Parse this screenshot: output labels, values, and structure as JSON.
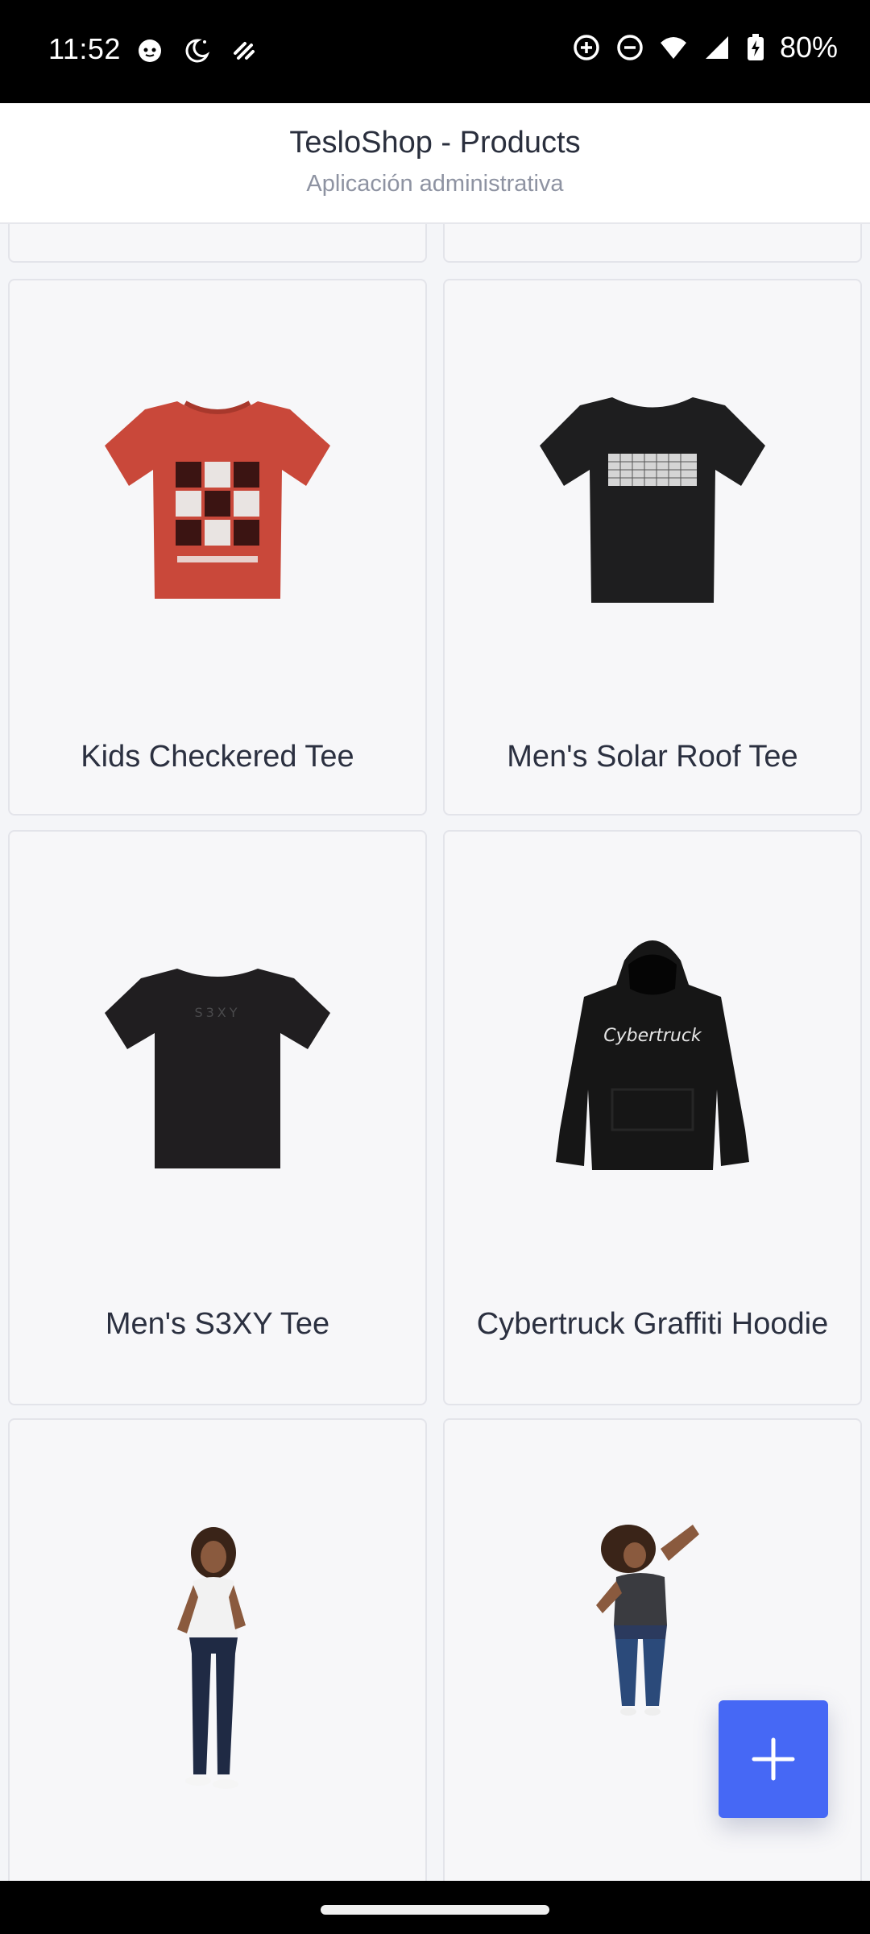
{
  "status_bar": {
    "time": "11:52",
    "battery": "80%",
    "left_icons": [
      "cat-face-icon",
      "moon-stars-icon",
      "squiggle-icon"
    ],
    "right_icons": [
      "data-saver-icon",
      "do-not-disturb-icon",
      "wifi-icon",
      "signal-icon",
      "battery-charging-icon"
    ]
  },
  "header": {
    "title": "TesloShop - Products",
    "subtitle": "Aplicación administrativa"
  },
  "products": [
    {
      "title": "Kids Checkered Tee",
      "image": "red-tee-image"
    },
    {
      "title": "Men's Solar Roof Tee",
      "image": "black-tee-image"
    },
    {
      "title": "Men's S3XY Tee",
      "image": "black-s3xy-tee-image"
    },
    {
      "title": "Cybertruck Graffiti Hoodie",
      "image": "black-hoodie-image"
    },
    {
      "title": "",
      "image": "woman-white-tee-image"
    },
    {
      "title": "",
      "image": "woman-dark-tee-image"
    }
  ],
  "fab": {
    "icon": "plus-icon"
  },
  "colors": {
    "accent": "#4668f5",
    "card_bg": "#f7f7f9",
    "title_text": "#2a2f3d",
    "subtitle_text": "#8e93a2"
  }
}
